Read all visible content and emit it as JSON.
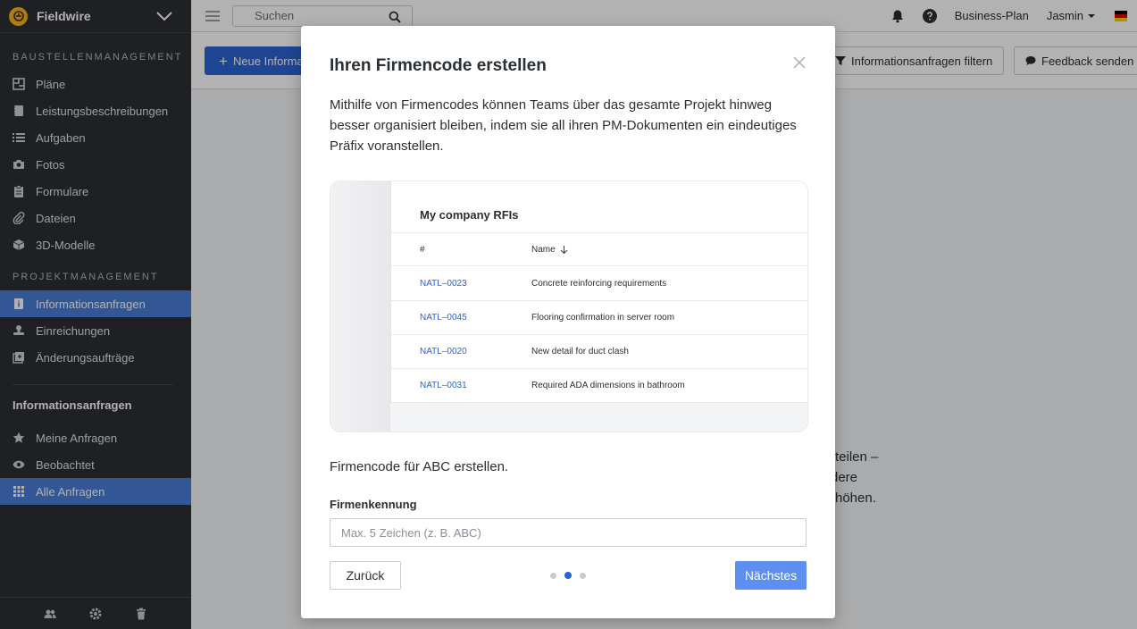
{
  "app": {
    "name": "Fieldwire"
  },
  "sidebar": {
    "section1_title": "BAUSTELLENMANAGEMENT",
    "section1_items": [
      {
        "label": "Pläne",
        "icon": "plans-icon"
      },
      {
        "label": "Leistungsbeschreibungen",
        "icon": "specs-icon"
      },
      {
        "label": "Aufgaben",
        "icon": "tasks-icon"
      },
      {
        "label": "Fotos",
        "icon": "camera-icon"
      },
      {
        "label": "Formulare",
        "icon": "forms-icon"
      },
      {
        "label": "Dateien",
        "icon": "paperclip-icon"
      },
      {
        "label": "3D-Modelle",
        "icon": "cube-icon"
      }
    ],
    "section2_title": "PROJEKTMANAGEMENT",
    "section2_items": [
      {
        "label": "Informationsanfragen",
        "icon": "rfi-icon",
        "active": true
      },
      {
        "label": "Einreichungen",
        "icon": "stamp-icon"
      },
      {
        "label": "Änderungsaufträge",
        "icon": "change-order-icon"
      }
    ],
    "sub_title": "Informationsanfragen",
    "sub_items": [
      {
        "label": "Meine Anfragen",
        "icon": "star-icon"
      },
      {
        "label": "Beobachtet",
        "icon": "eye-icon"
      },
      {
        "label": "Alle Anfragen",
        "icon": "grid-icon",
        "active": true
      }
    ]
  },
  "topbar": {
    "search_placeholder": "Suchen",
    "plan": "Business-Plan",
    "user": "Jasmin"
  },
  "toolbar": {
    "new_button": "Neue Informationsanfrage",
    "filter_button": "Informationsanfragen filtern",
    "feedback_button": "Feedback senden"
  },
  "background_text": {
    "line1": "rteilen –",
    "line2": "dere",
    "line3": "rhöhen."
  },
  "modal": {
    "title": "Ihren Firmencode erstellen",
    "description": "Mithilfe von Firmencodes können Teams über das gesamte Projekt hinweg besser organisiert bleiben, indem sie all ihren PM-Dokumenten ein eindeutiges Präfix voranstellen.",
    "preview": {
      "title": "My company RFIs",
      "col_id": "#",
      "col_name": "Name",
      "rows": [
        {
          "id": "NATL–0023",
          "name": "Concrete reinforcing requirements"
        },
        {
          "id": "NATL–0045",
          "name": "Flooring confirmation in server room"
        },
        {
          "id": "NATL–0020",
          "name": "New detail for duct clash"
        },
        {
          "id": "NATL–0031",
          "name": "Required ADA dimensions in bathroom"
        }
      ]
    },
    "subline": "Firmencode für ABC erstellen.",
    "field_label": "Firmenkennung",
    "field_placeholder": "Max. 5 Zeichen (z. B. ABC)",
    "field_value": "",
    "back_button": "Zurück",
    "next_button": "Nächstes",
    "step_current": 2,
    "step_total": 3
  },
  "colors": {
    "accent": "#2a63d4",
    "sidebar_bg": "#2b2f33",
    "active_item": "#4a7bd4",
    "brand": "#f5b31b"
  }
}
